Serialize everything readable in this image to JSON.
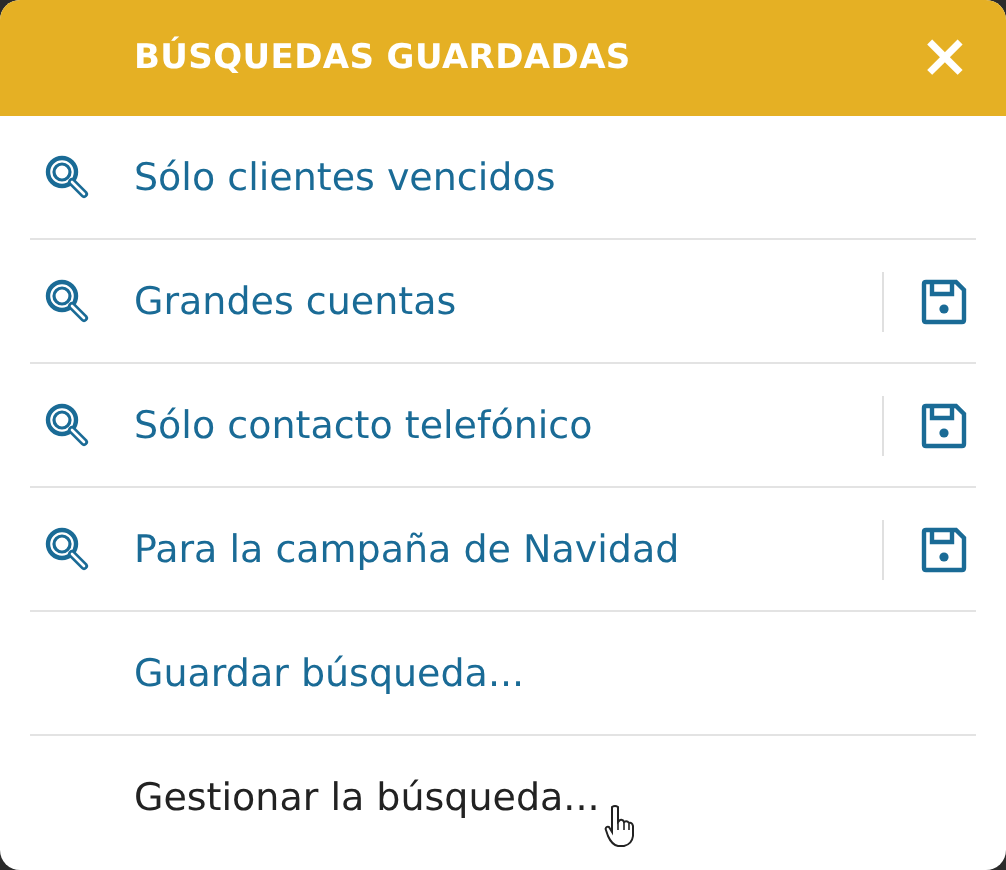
{
  "dialog": {
    "title": "BÚSQUEDAS GUARDADAS",
    "close": "×"
  },
  "searches": [
    {
      "label": "Sólo clientes vencidos",
      "saveable": false
    },
    {
      "label": "Grandes cuentas",
      "saveable": true
    },
    {
      "label": "Sólo contacto telefónico",
      "saveable": true
    },
    {
      "label": "Para la campaña de Navidad",
      "saveable": true
    }
  ],
  "actions": [
    {
      "label": "Guardar búsqueda...",
      "hovered": false
    },
    {
      "label": "Gestionar la búsqueda...",
      "hovered": true
    }
  ]
}
